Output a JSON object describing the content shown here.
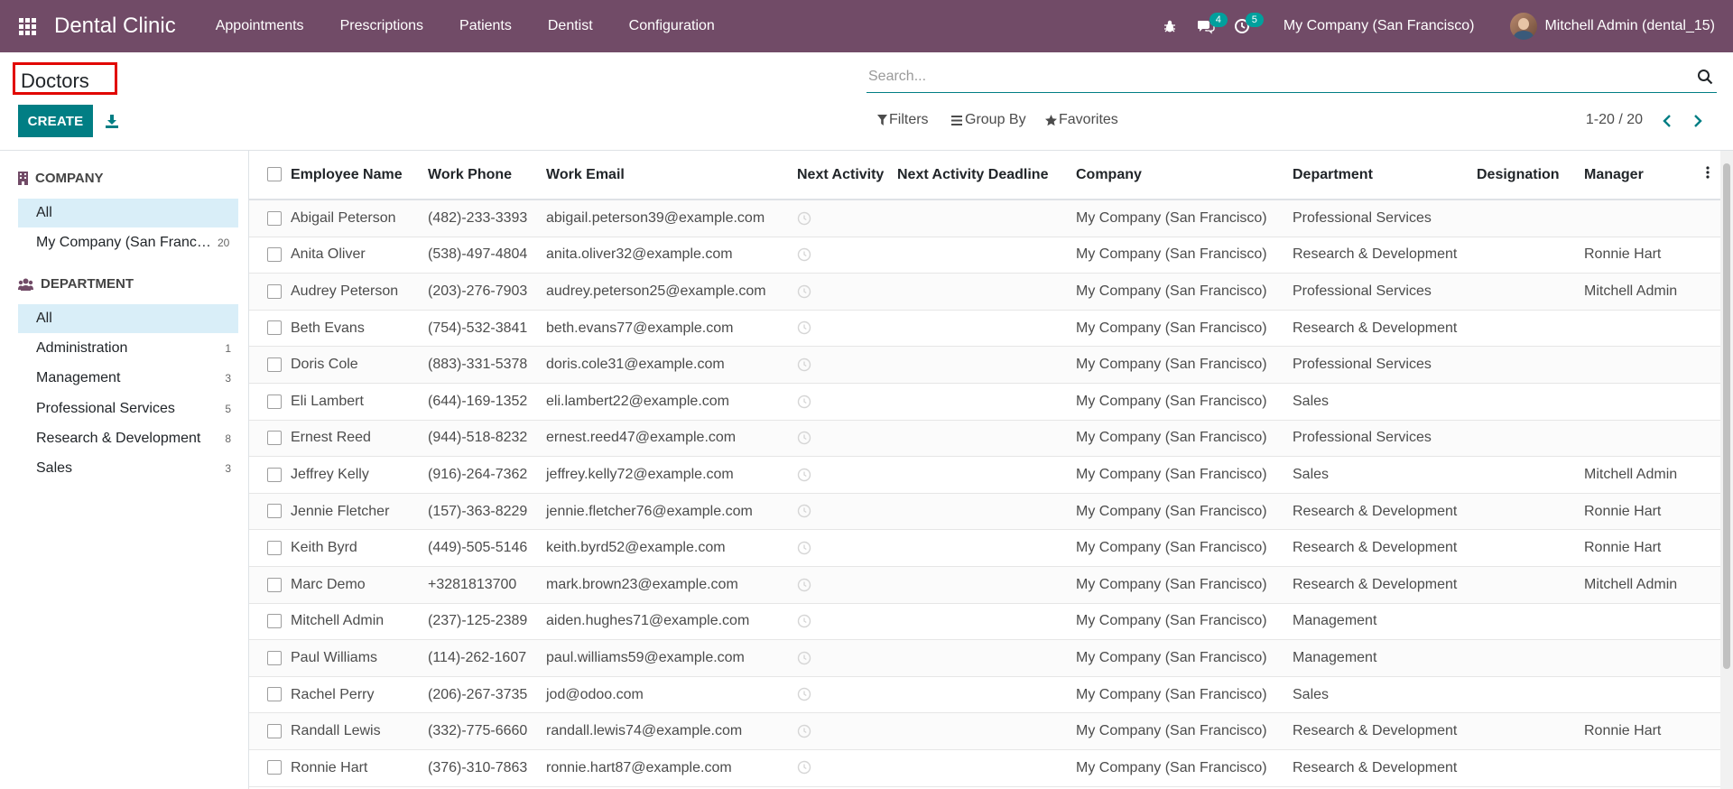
{
  "navbar": {
    "brand": "Dental Clinic",
    "menu": [
      "Appointments",
      "Prescriptions",
      "Patients",
      "Dentist",
      "Configuration"
    ],
    "messages_count": "4",
    "activities_count": "5",
    "company": "My Company (San Francisco)",
    "user": "Mitchell Admin (dental_15)"
  },
  "control": {
    "title": "Doctors",
    "create_label": "CREATE",
    "search_placeholder": "Search...",
    "filters_label": "Filters",
    "groupby_label": "Group By",
    "favorites_label": "Favorites",
    "pager": "1-20 / 20"
  },
  "sidebar": {
    "company_header": "COMPANY",
    "company_items": [
      {
        "label": "All",
        "count": ""
      },
      {
        "label": "My Company (San Francisco)",
        "count": "20"
      }
    ],
    "department_header": "DEPARTMENT",
    "department_items": [
      {
        "label": "All",
        "count": ""
      },
      {
        "label": "Administration",
        "count": "1"
      },
      {
        "label": "Management",
        "count": "3"
      },
      {
        "label": "Professional Services",
        "count": "5"
      },
      {
        "label": "Research & Development",
        "count": "8"
      },
      {
        "label": "Sales",
        "count": "3"
      }
    ]
  },
  "table": {
    "headers": [
      "Employee Name",
      "Work Phone",
      "Work Email",
      "Next Activity",
      "Next Activity Deadline",
      "Company",
      "Department",
      "Designation",
      "Manager"
    ],
    "rows": [
      [
        "Abigail Peterson",
        "(482)-233-3393",
        "abigail.peterson39@example.com",
        "",
        "",
        "My Company (San Francisco)",
        "Professional Services",
        "",
        ""
      ],
      [
        "Anita Oliver",
        "(538)-497-4804",
        "anita.oliver32@example.com",
        "",
        "",
        "My Company (San Francisco)",
        "Research & Development",
        "",
        "Ronnie Hart"
      ],
      [
        "Audrey Peterson",
        "(203)-276-7903",
        "audrey.peterson25@example.com",
        "",
        "",
        "My Company (San Francisco)",
        "Professional Services",
        "",
        "Mitchell Admin"
      ],
      [
        "Beth Evans",
        "(754)-532-3841",
        "beth.evans77@example.com",
        "",
        "",
        "My Company (San Francisco)",
        "Research & Development",
        "",
        ""
      ],
      [
        "Doris Cole",
        "(883)-331-5378",
        "doris.cole31@example.com",
        "",
        "",
        "My Company (San Francisco)",
        "Professional Services",
        "",
        ""
      ],
      [
        "Eli Lambert",
        "(644)-169-1352",
        "eli.lambert22@example.com",
        "",
        "",
        "My Company (San Francisco)",
        "Sales",
        "",
        ""
      ],
      [
        "Ernest Reed",
        "(944)-518-8232",
        "ernest.reed47@example.com",
        "",
        "",
        "My Company (San Francisco)",
        "Professional Services",
        "",
        ""
      ],
      [
        "Jeffrey Kelly",
        "(916)-264-7362",
        "jeffrey.kelly72@example.com",
        "",
        "",
        "My Company (San Francisco)",
        "Sales",
        "",
        "Mitchell Admin"
      ],
      [
        "Jennie Fletcher",
        "(157)-363-8229",
        "jennie.fletcher76@example.com",
        "",
        "",
        "My Company (San Francisco)",
        "Research & Development",
        "",
        "Ronnie Hart"
      ],
      [
        "Keith Byrd",
        "(449)-505-5146",
        "keith.byrd52@example.com",
        "",
        "",
        "My Company (San Francisco)",
        "Research & Development",
        "",
        "Ronnie Hart"
      ],
      [
        "Marc Demo",
        "+3281813700",
        "mark.brown23@example.com",
        "",
        "",
        "My Company (San Francisco)",
        "Research & Development",
        "",
        "Mitchell Admin"
      ],
      [
        "Mitchell Admin",
        "(237)-125-2389",
        "aiden.hughes71@example.com",
        "",
        "",
        "My Company (San Francisco)",
        "Management",
        "",
        ""
      ],
      [
        "Paul Williams",
        "(114)-262-1607",
        "paul.williams59@example.com",
        "",
        "",
        "My Company (San Francisco)",
        "Management",
        "",
        ""
      ],
      [
        "Rachel Perry",
        "(206)-267-3735",
        "jod@odoo.com",
        "",
        "",
        "My Company (San Francisco)",
        "Sales",
        "",
        ""
      ],
      [
        "Randall Lewis",
        "(332)-775-6660",
        "randall.lewis74@example.com",
        "",
        "",
        "My Company (San Francisco)",
        "Research & Development",
        "",
        "Ronnie Hart"
      ],
      [
        "Ronnie Hart",
        "(376)-310-7863",
        "ronnie.hart87@example.com",
        "",
        "",
        "My Company (San Francisco)",
        "Research & Development",
        "",
        ""
      ]
    ]
  }
}
